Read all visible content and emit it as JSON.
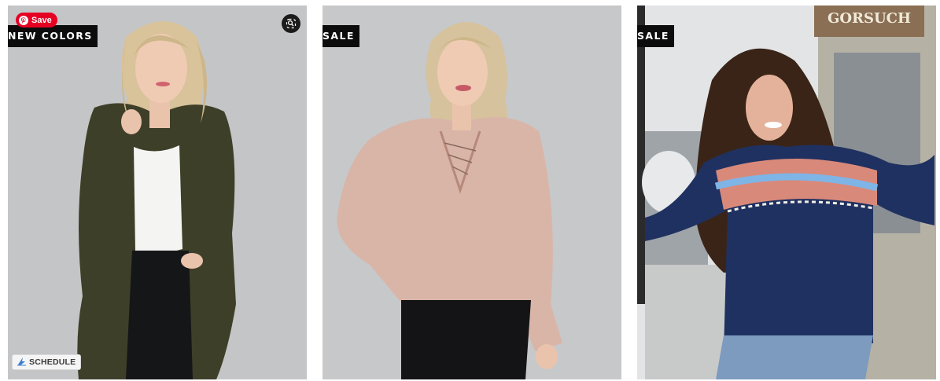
{
  "products": [
    {
      "badge": "NEW COLORS",
      "image_icon": "woman-olive-cardigan-photo",
      "bg": "#c3c4c6"
    },
    {
      "badge": "SALE",
      "image_icon": "woman-pink-lace-up-sweater-photo",
      "bg": "#c6c7c9"
    },
    {
      "badge": "SALE",
      "image_icon": "woman-navy-fair-isle-sweater-photo",
      "bg": "#d9dbdc",
      "sign_text": "GORSUCH"
    }
  ],
  "pinterest": {
    "save_label": "Save",
    "icon": "pinterest-icon",
    "color": "#e60023"
  },
  "zoom": {
    "icon": "zoom-icon"
  },
  "schedule": {
    "label": "SCHEDULE",
    "icon": "schedule-icon"
  }
}
